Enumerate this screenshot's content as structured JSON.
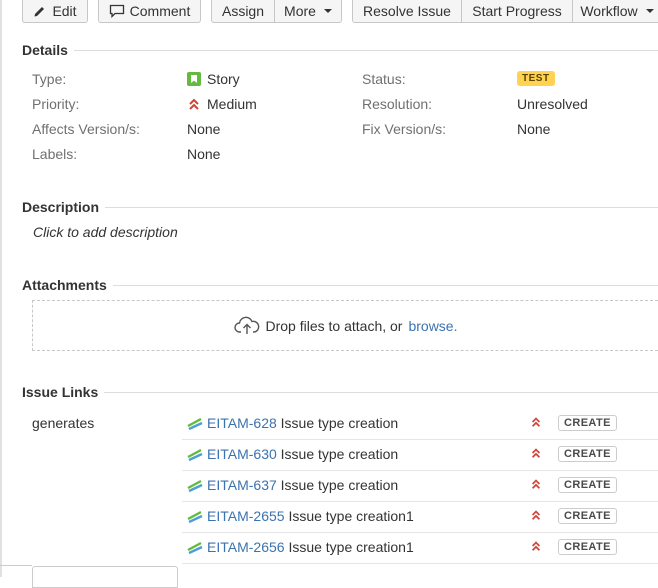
{
  "toolbar": {
    "edit": "Edit",
    "comment": "Comment",
    "assign": "Assign",
    "more": "More",
    "resolve": "Resolve Issue",
    "start_progress": "Start Progress",
    "workflow": "Workflow"
  },
  "details": {
    "title": "Details",
    "type_label": "Type:",
    "type_value": "Story",
    "priority_label": "Priority:",
    "priority_value": "Medium",
    "affects_label": "Affects Version/s:",
    "affects_value": "None",
    "labels_label": "Labels:",
    "labels_value": "None",
    "status_label": "Status:",
    "status_value": "TEST",
    "resolution_label": "Resolution:",
    "resolution_value": "Unresolved",
    "fix_label": "Fix Version/s:",
    "fix_value": "None"
  },
  "description": {
    "title": "Description",
    "placeholder": "Click to add description"
  },
  "attachments": {
    "title": "Attachments",
    "drop_text": "Drop files to attach, or",
    "browse": "browse."
  },
  "issue_links": {
    "title": "Issue Links",
    "relation": "generates",
    "items": [
      {
        "key": "EITAM-628",
        "summary": "Issue type creation",
        "status": "CREATE"
      },
      {
        "key": "EITAM-630",
        "summary": "Issue type creation",
        "status": "CREATE"
      },
      {
        "key": "EITAM-637",
        "summary": "Issue type creation",
        "status": "CREATE"
      },
      {
        "key": "EITAM-2655",
        "summary": "Issue type creation1",
        "status": "CREATE"
      },
      {
        "key": "EITAM-2656",
        "summary": "Issue type creation1",
        "status": "CREATE"
      }
    ]
  },
  "colors": {
    "link": "#3b73af",
    "priority": "#d04437",
    "badge": "#ffd351",
    "story": "#63ba3c"
  },
  "icons": [
    "pencil-icon",
    "comment-icon",
    "story-icon",
    "priority-medium-icon",
    "cloud-upload-icon",
    "subtask-icon"
  ]
}
